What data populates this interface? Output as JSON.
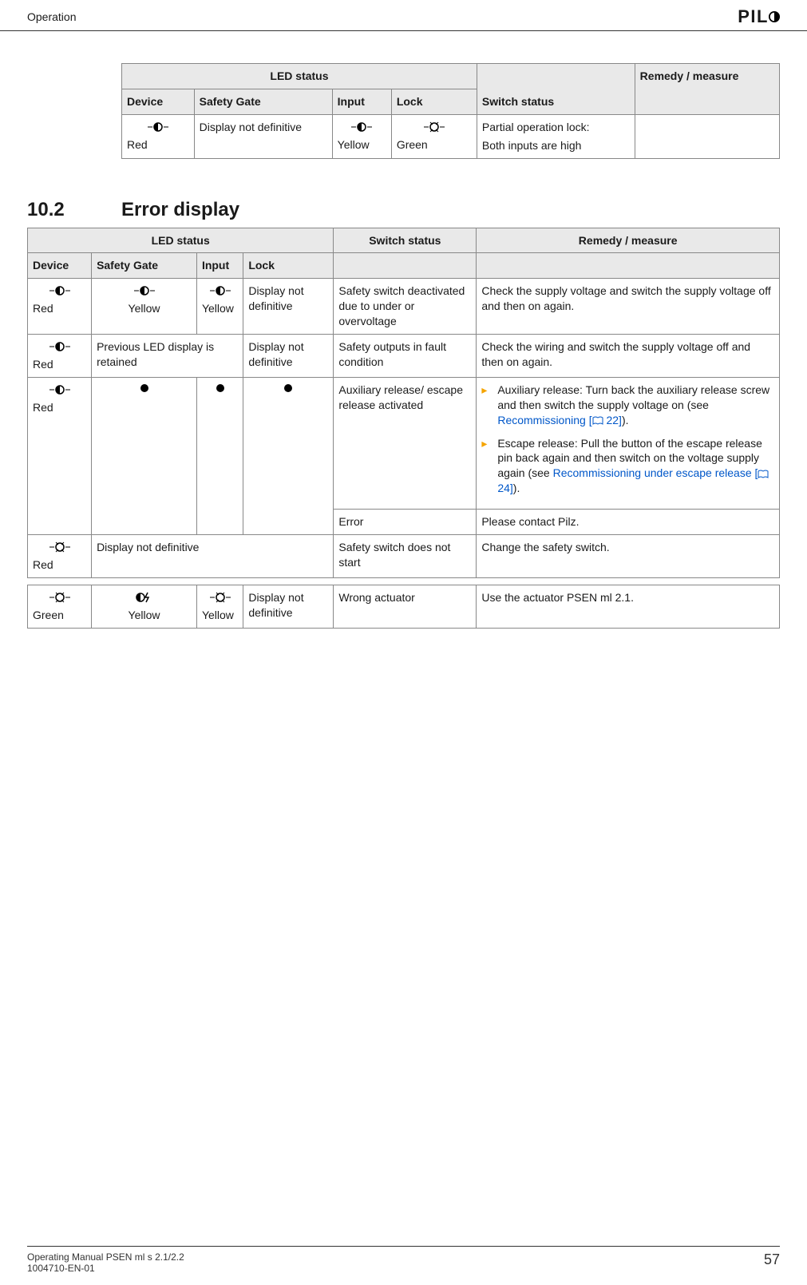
{
  "header": {
    "section": "Operation",
    "brand": "PILZ"
  },
  "table1": {
    "headers": {
      "led_status": "LED status",
      "device": "Device",
      "safety_gate": "Safety Gate",
      "input": "Input",
      "lock": "Lock",
      "switch_status": "Switch status",
      "remedy": "Remedy / measure"
    },
    "row": {
      "device_color": "Red",
      "safety_gate": "Display not definitive",
      "input_color": "Yellow",
      "lock_color": "Green",
      "switch_status_1": "Partial operation lock:",
      "switch_status_2": "Both inputs are high",
      "remedy": ""
    }
  },
  "section_10_2": {
    "num": "10.2",
    "title": "Error display"
  },
  "table2": {
    "headers": {
      "led_status": "LED status",
      "device": "Device",
      "safety_gate": "Safety Gate",
      "input": "Input",
      "lock": "Lock",
      "switch_status": "Switch status",
      "remedy": "Remedy / measure"
    },
    "rows": [
      {
        "device_color": "Red",
        "safety_gate_color": "Yellow",
        "input_color": "Yellow",
        "lock": "Display not definitive",
        "switch_status": "Safety switch deactivated due to under or overvoltage",
        "remedy": "Check the supply voltage and switch the supply voltage off and then on again."
      },
      {
        "device_color": "Red",
        "safety_gate_span": "Previous LED display is retained",
        "lock": "Display not definitive",
        "switch_status": "Safety outputs in fault condition",
        "remedy": "Check the wiring and switch the supply voltage off and then on again."
      },
      {
        "device_color": "Red",
        "switch_status": "Auxiliary release/ escape release activated",
        "remedy_items": [
          {
            "pre": "Auxiliary release: Turn back the auxiliary release screw and then switch the supply voltage on (see ",
            "link": "Recommissioning [",
            "page": " 22]",
            "post": ")."
          },
          {
            "pre": "Escape release: Pull the button of the escape release pin back again and then switch on the voltage supply again (see ",
            "link": "Recommissioning under escape release [",
            "page": " 24]",
            "post": ")."
          }
        ]
      },
      {
        "switch_status": "Error",
        "remedy": "Please contact Pilz."
      },
      {
        "device_color": "Red",
        "safety_gate_span": "Display not definitive",
        "switch_status": "Safety switch does not start",
        "remedy": "Change the safety switch."
      }
    ]
  },
  "table3": {
    "row": {
      "device_color": "Green",
      "safety_gate_color": "Yellow",
      "input_color": "Yellow",
      "lock": "Display not definitive",
      "switch_status": "Wrong actuator",
      "remedy": "Use the actuator PSEN ml 2.1."
    }
  },
  "footer": {
    "line1": "Operating Manual PSEN ml s 2.1/2.2",
    "line2": "1004710-EN-01",
    "page": "57"
  }
}
